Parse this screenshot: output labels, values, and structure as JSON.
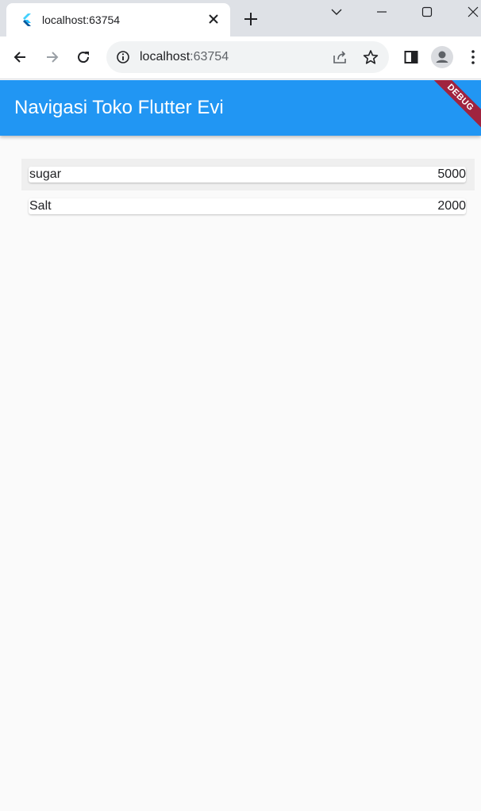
{
  "browser": {
    "tab": {
      "title": "localhost:63754",
      "favicon": "flutter-icon"
    },
    "address_bar": {
      "host": "localhost",
      "port": ":63754"
    },
    "icons": [
      "chevron-down-icon",
      "minimize-icon",
      "maximize-icon",
      "close-icon",
      "back-icon",
      "forward-icon",
      "reload-icon",
      "info-icon",
      "share-icon",
      "star-icon",
      "side-panel-icon",
      "profile-icon",
      "more-icon",
      "new-tab-icon"
    ]
  },
  "app": {
    "title": "Navigasi Toko Flutter Evi",
    "debug_banner": "DEBUG",
    "primary_color": "#2196f3",
    "items": [
      {
        "name": "sugar",
        "price": "5000"
      },
      {
        "name": "Salt",
        "price": "2000"
      }
    ]
  }
}
